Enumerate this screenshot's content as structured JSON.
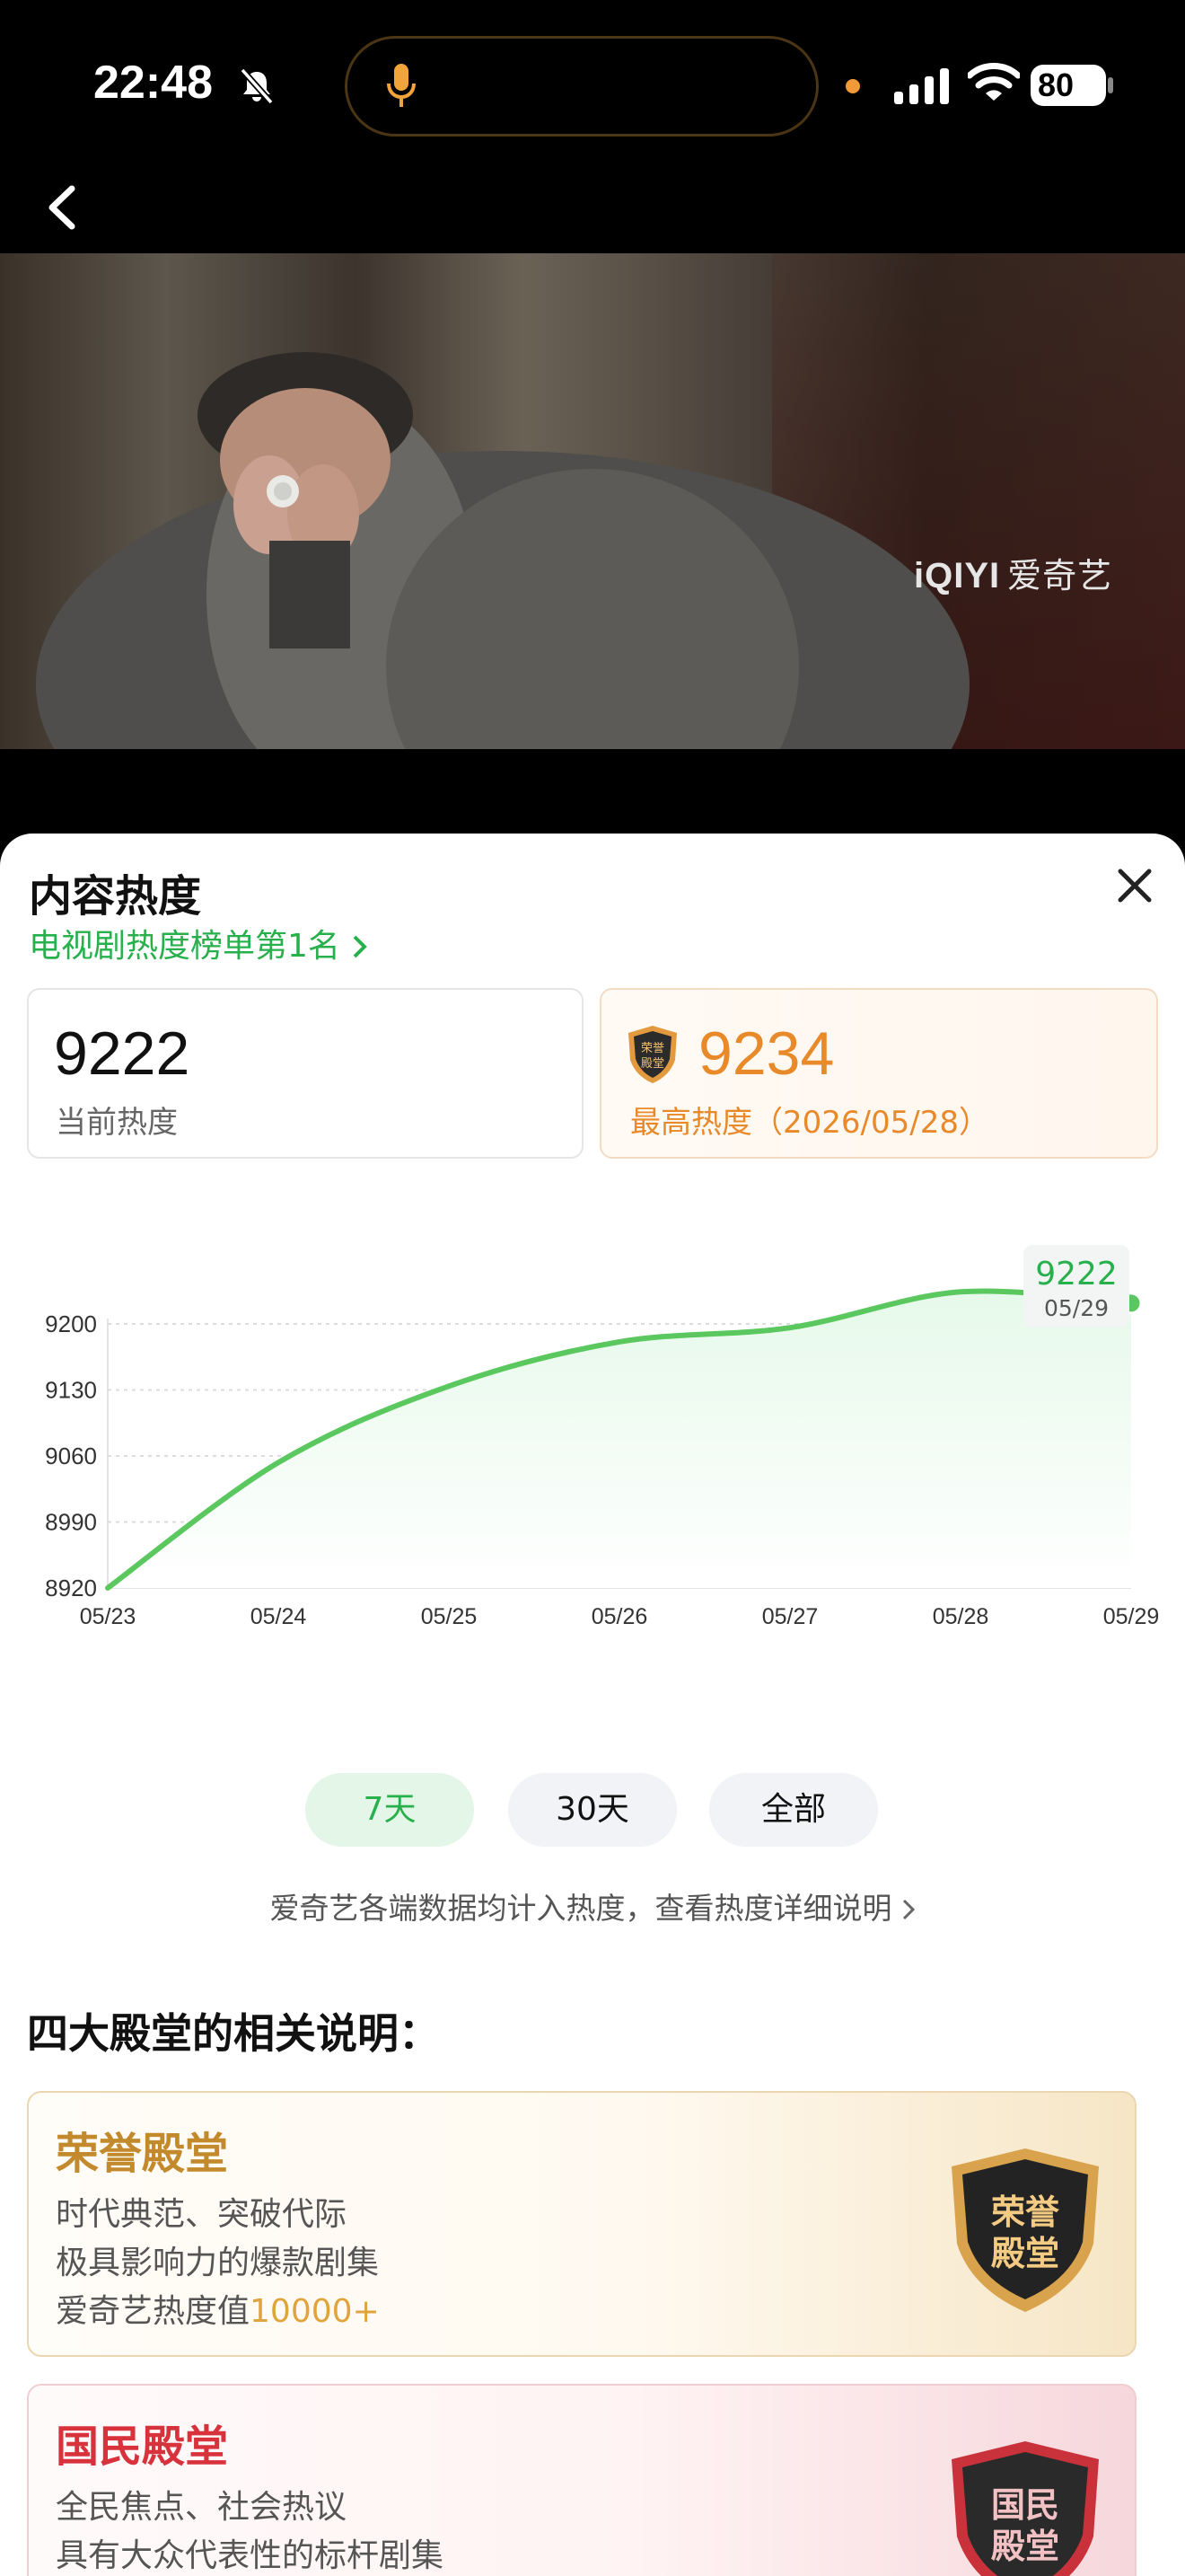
{
  "status_bar": {
    "time": "22:48",
    "battery": "80"
  },
  "video": {
    "watermark_latin": "iQIYI",
    "watermark_cn": "爱奇艺"
  },
  "sheet": {
    "title": "内容热度",
    "rank_link": "电视剧热度榜单第1名",
    "current": {
      "value": "9222",
      "label": "当前热度"
    },
    "peak": {
      "value": "9234",
      "label": "最高热度（2026/05/28）",
      "badge_text": "荣誉殿堂"
    },
    "tooltip": {
      "value": "9222",
      "date": "05/29"
    },
    "ranges": [
      "7天",
      "30天",
      "全部"
    ],
    "selected_range": "7天",
    "note": "爱奇艺各端数据均计入热度，查看热度详细说明"
  },
  "chart_data": {
    "type": "area",
    "x": [
      "05/23",
      "05/24",
      "05/25",
      "05/26",
      "05/27",
      "05/28",
      "05/29"
    ],
    "y": [
      8920,
      9053,
      9134,
      9181,
      9196,
      9234,
      9222
    ],
    "ylim": [
      8920,
      9200
    ],
    "yticks": [
      8920,
      8990,
      9060,
      9130,
      9200
    ],
    "colors": {
      "line": "#5bc85f",
      "fill": "#e6f9ea"
    }
  },
  "halls": {
    "title": "四大殿堂的相关说明：",
    "items": [
      {
        "name": "荣誉殿堂",
        "line1": "时代典范、突破代际",
        "line2": "极具影响力的爆款剧集",
        "line3_prefix": "爱奇艺热度值",
        "line3_highlight": "10000+",
        "badge_line1": "荣誉",
        "badge_line2": "殿堂"
      },
      {
        "name": "国民殿堂",
        "line1": "全民焦点、社会热议",
        "line2": "具有大众代表性的标杆剧集",
        "badge_line1": "国民",
        "badge_line2": "殿堂"
      }
    ]
  }
}
